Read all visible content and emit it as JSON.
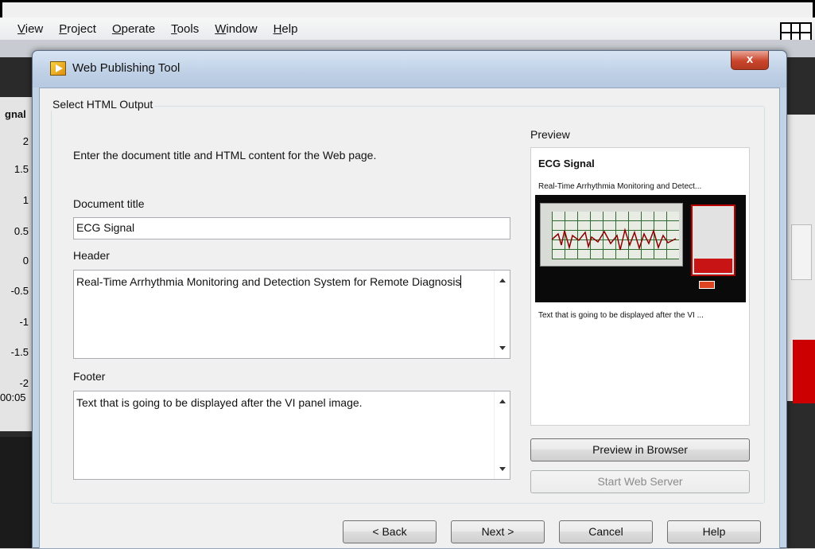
{
  "menu": [
    {
      "label": "View",
      "key": "V",
      "rest": "iew"
    },
    {
      "label": "Project",
      "key": "P",
      "rest": "roject"
    },
    {
      "label": "Operate",
      "key": "O",
      "rest": "perate"
    },
    {
      "label": "Tools",
      "key": "T",
      "rest": "ools"
    },
    {
      "label": "Window",
      "key": "W",
      "rest": "indow"
    },
    {
      "label": "Help",
      "key": "H",
      "rest": "elp"
    }
  ],
  "background_plot": {
    "title": "gnal",
    "y_ticks": [
      "2",
      "1.5",
      "1",
      "0.5",
      "0",
      "-0.5",
      "-1",
      "-1.5",
      "-2"
    ],
    "x_start": "00:05"
  },
  "dialog": {
    "title": "Web Publishing Tool",
    "close_label": "x",
    "group_label": "Select HTML Output",
    "instruction": "Enter the document title and HTML content for the Web page.",
    "document_title": {
      "label": "Document title",
      "value": "ECG Signal"
    },
    "header": {
      "label": "Header",
      "value": "Real-Time Arrhythmia Monitoring and Detection System for Remote Diagnosis"
    },
    "footer": {
      "label": "Footer",
      "value": "Text that is going to be displayed after the VI panel image."
    },
    "preview": {
      "label": "Preview",
      "title": "ECG Signal",
      "header": "Real-Time Arrhythmia Monitoring and Detect...",
      "footer": "Text that is going to be displayed after the VI ..."
    },
    "buttons": {
      "preview_in_browser": "Preview in Browser",
      "start_web_server": "Start Web Server",
      "back": "< Back",
      "next": "Next >",
      "cancel": "Cancel",
      "help": "Help"
    }
  }
}
